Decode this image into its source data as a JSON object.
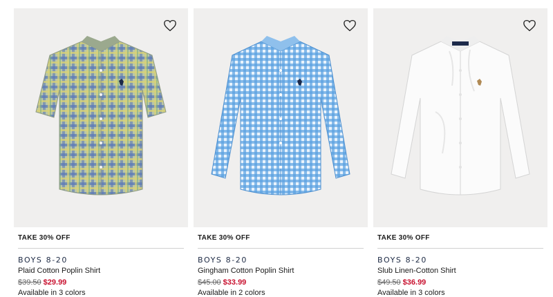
{
  "products": [
    {
      "promo": "TAKE 30% OFF",
      "category": "BOYS 8-20",
      "name": "Plaid Cotton Poplin Shirt",
      "original_price": "$39.50",
      "sale_price": "$29.99",
      "colors_text": "Available in 3 colors",
      "image_bg": "#f0efee",
      "shirt_color": "#a9b8a0",
      "pattern_a": "#5b79b8",
      "pattern_b": "#d8d276",
      "pattern_c": "#7fb184",
      "logo_color": "#1c2a4a",
      "icon": "heart-icon"
    },
    {
      "promo": "TAKE 30% OFF",
      "category": "BOYS 8-20",
      "name": "Gingham Cotton Poplin Shirt",
      "original_price": "$45.00",
      "sale_price": "$33.99",
      "colors_text": "Available in 2 colors",
      "image_bg": "#f0efee",
      "shirt_color": "#7fb6ea",
      "pattern_a": "#3f8ed8",
      "pattern_b": "#e9f3fc",
      "pattern_c": "#5aa2e2",
      "logo_color": "#1c2a4a",
      "icon": "heart-icon"
    },
    {
      "promo": "TAKE 30% OFF",
      "category": "BOYS 8-20",
      "name": "Slub Linen-Cotton Shirt",
      "original_price": "$49.50",
      "sale_price": "$36.99",
      "colors_text": "Available in 3 colors",
      "image_bg": "#f0efee",
      "shirt_color": "#fbfbfb",
      "pattern_a": "#f1f1f1",
      "pattern_b": "#ffffff",
      "pattern_c": "#e8e8e8",
      "logo_color": "#b08a55",
      "icon": "heart-icon"
    }
  ]
}
